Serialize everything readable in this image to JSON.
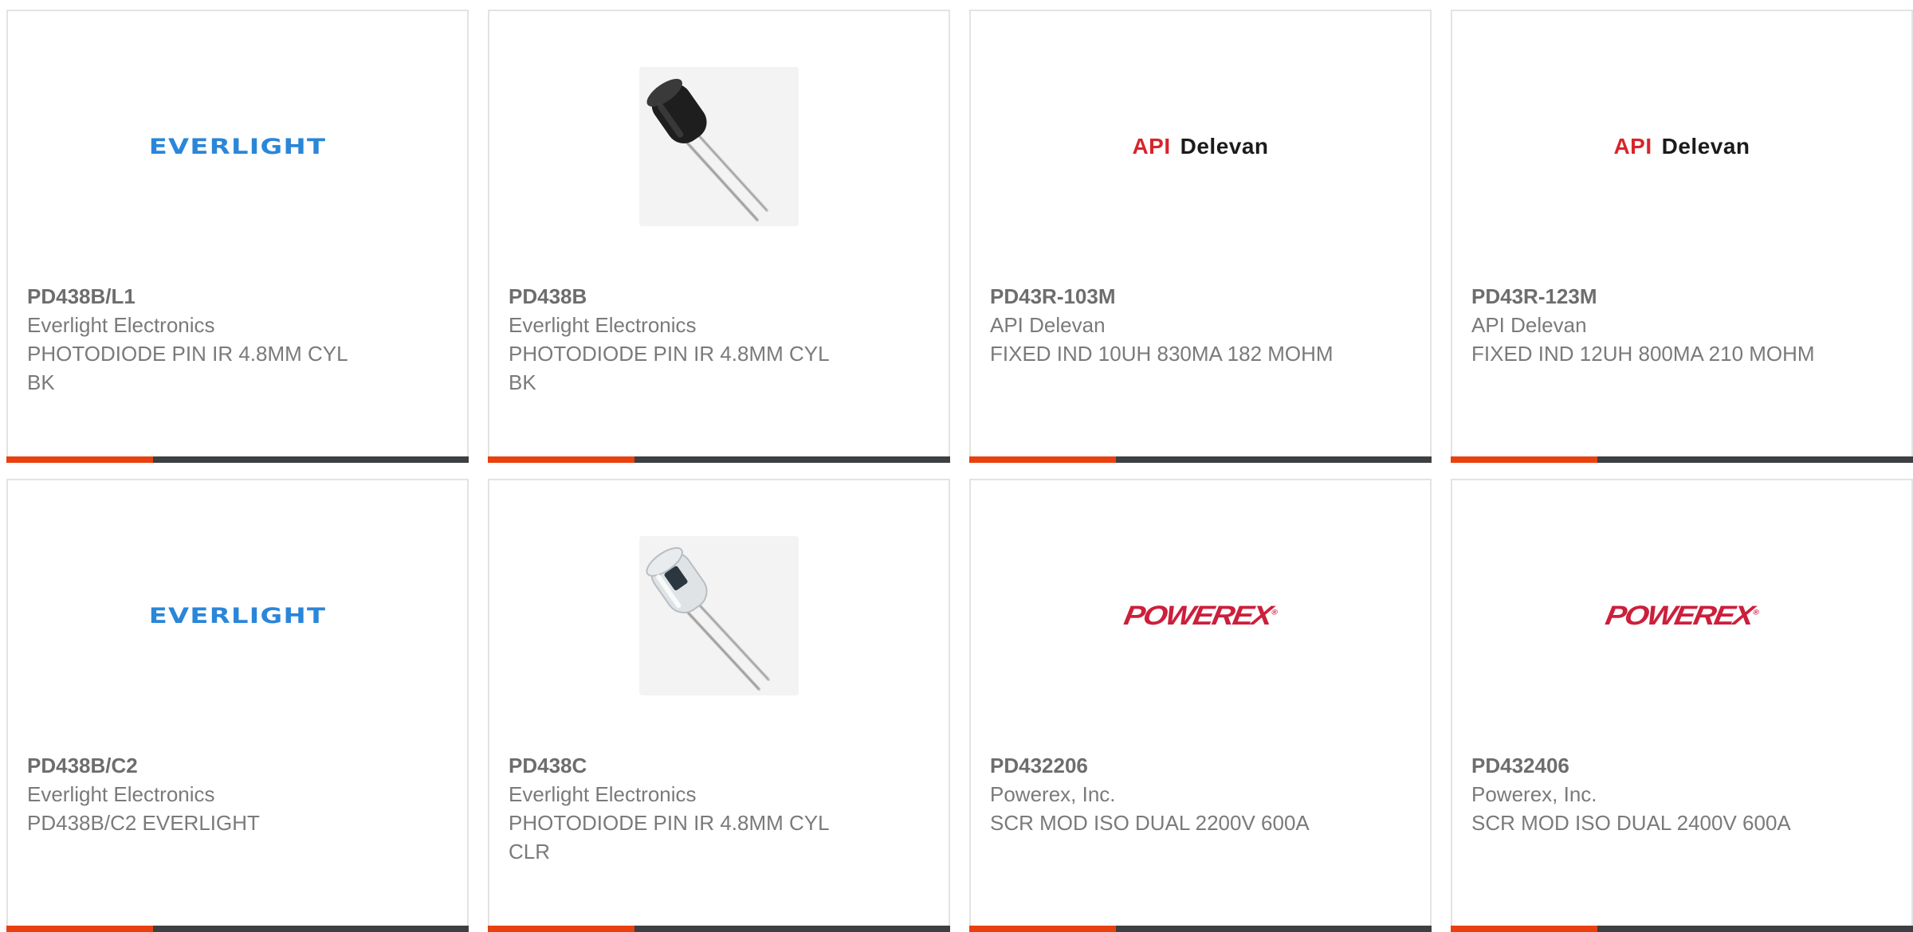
{
  "colors": {
    "accent": "#e8410f",
    "bar": "#3d3f42",
    "everlight": "#2a86d9",
    "api_red": "#d8242b",
    "api_dark": "#1b1b1b",
    "powerex_red": "#cc1f3c"
  },
  "products": [
    {
      "part": "PD438B/L1",
      "manufacturer": "Everlight Electronics",
      "description": "PHOTODIODE PIN IR 4.8MM CYL BK",
      "image": "everlight-logo"
    },
    {
      "part": "PD438B",
      "manufacturer": "Everlight Electronics",
      "description": "PHOTODIODE PIN IR 4.8MM CYL BK",
      "image": "photodiode-black-photo"
    },
    {
      "part": "PD43R-103M",
      "manufacturer": "API Delevan",
      "description": "FIXED IND 10UH 830MA 182 MOHM",
      "image": "api-delevan-logo"
    },
    {
      "part": "PD43R-123M",
      "manufacturer": "API Delevan",
      "description": "FIXED IND 12UH 800MA 210 MOHM",
      "image": "api-delevan-logo"
    },
    {
      "part": "PD438B/C2",
      "manufacturer": "Everlight Electronics",
      "description": "PD438B/C2 EVERLIGHT",
      "image": "everlight-logo"
    },
    {
      "part": "PD438C",
      "manufacturer": "Everlight Electronics",
      "description": "PHOTODIODE PIN IR 4.8MM CYL CLR",
      "image": "photodiode-clear-photo"
    },
    {
      "part": "PD432206",
      "manufacturer": "Powerex, Inc.",
      "description": "SCR MOD ISO DUAL 2200V 600A",
      "image": "powerex-logo"
    },
    {
      "part": "PD432406",
      "manufacturer": "Powerex, Inc.",
      "description": "SCR MOD ISO DUAL 2400V 600A",
      "image": "powerex-logo"
    }
  ],
  "logos": {
    "everlight": "EVERLIGHT",
    "api": "API",
    "delevan": "Delevan",
    "powerex": "POWEREX"
  }
}
